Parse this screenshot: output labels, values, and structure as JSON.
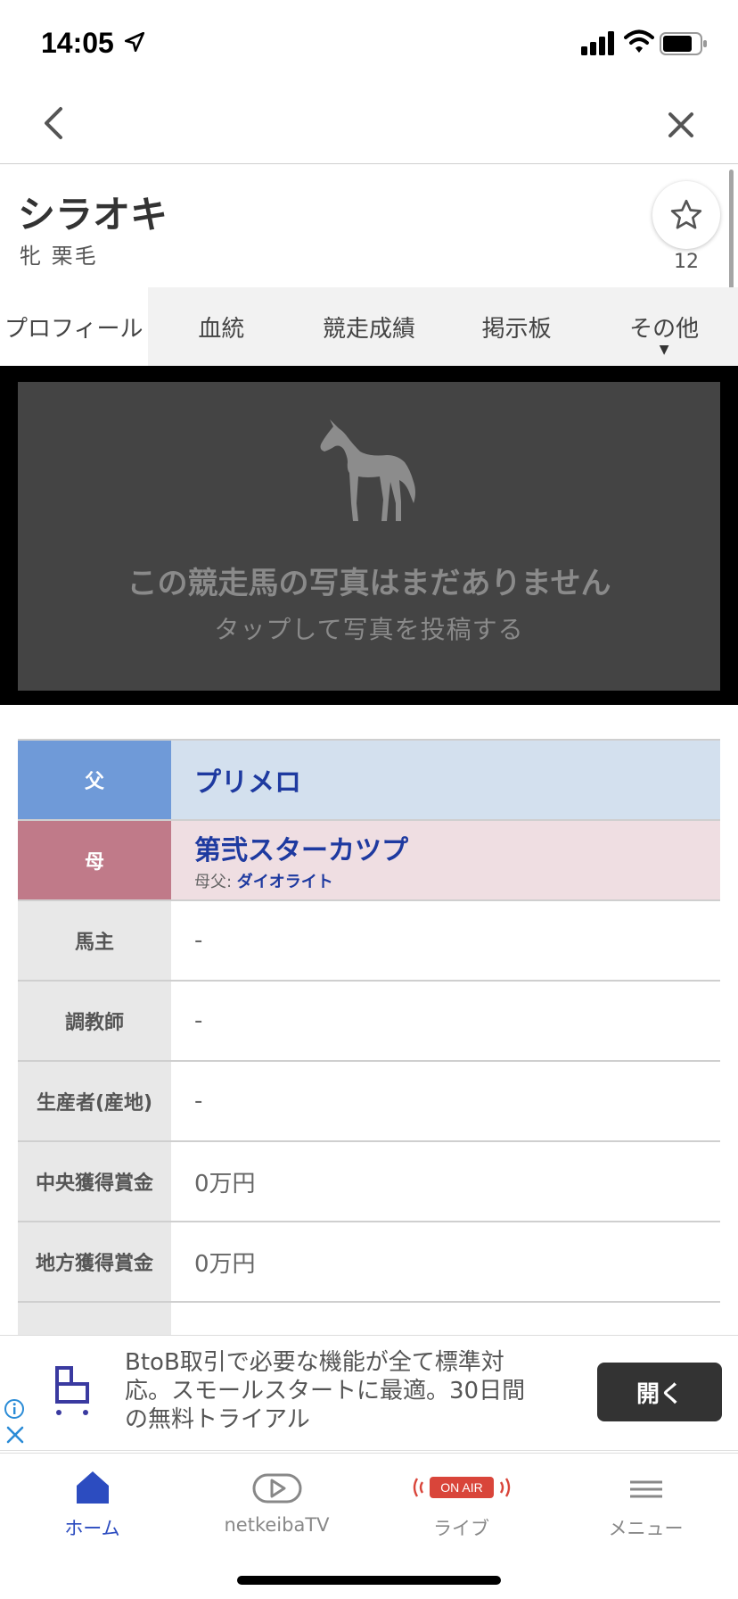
{
  "status_bar": {
    "time": "14:05"
  },
  "horse": {
    "name": "シラオキ",
    "sub": "牝  栗毛",
    "favorite_count": "12"
  },
  "tabs": [
    {
      "label": "プロフィール",
      "active": true
    },
    {
      "label": "血統"
    },
    {
      "label": "競走成績"
    },
    {
      "label": "掲示板"
    },
    {
      "label": "その他",
      "arrow": "▼"
    }
  ],
  "photo": {
    "message": "この競走馬の写真はまだありません",
    "sub": "タップして写真を投稿する"
  },
  "profile": {
    "sire_label": "父",
    "sire": "プリメロ",
    "dam_label": "母",
    "dam": "第弐スターカツプ",
    "dam_sire_label": "母父: ",
    "dam_sire": "ダイオライト",
    "rows": [
      {
        "label": "馬主",
        "value": "-"
      },
      {
        "label": "調教師",
        "value": "-"
      },
      {
        "label": "生産者(産地)",
        "value": "-"
      },
      {
        "label": "中央獲得賞金",
        "value": "0万円"
      },
      {
        "label": "地方獲得賞金",
        "value": "0万円"
      }
    ]
  },
  "ad": {
    "text": "BtoB取引で必要な機能が全て標準対応。スモールスタートに最適。30日間の無料トライアル",
    "button": "開く"
  },
  "tab_bar": [
    {
      "label": "ホーム",
      "icon": "home-icon",
      "active": true
    },
    {
      "label": "netkeibaTV",
      "icon": "tv-play-icon"
    },
    {
      "label": "ライブ",
      "icon": "on-air-icon",
      "badge": "ON AIR"
    },
    {
      "label": "メニュー",
      "icon": "menu-icon"
    }
  ],
  "colors": {
    "sire_label_bg": "#6f9ad8",
    "sire_value_bg": "#d3e0ee",
    "dam_label_bg": "#c07a89",
    "dam_value_bg": "#efdee2",
    "link": "#1e3aa0",
    "active_tab": "#2c4cc0"
  }
}
